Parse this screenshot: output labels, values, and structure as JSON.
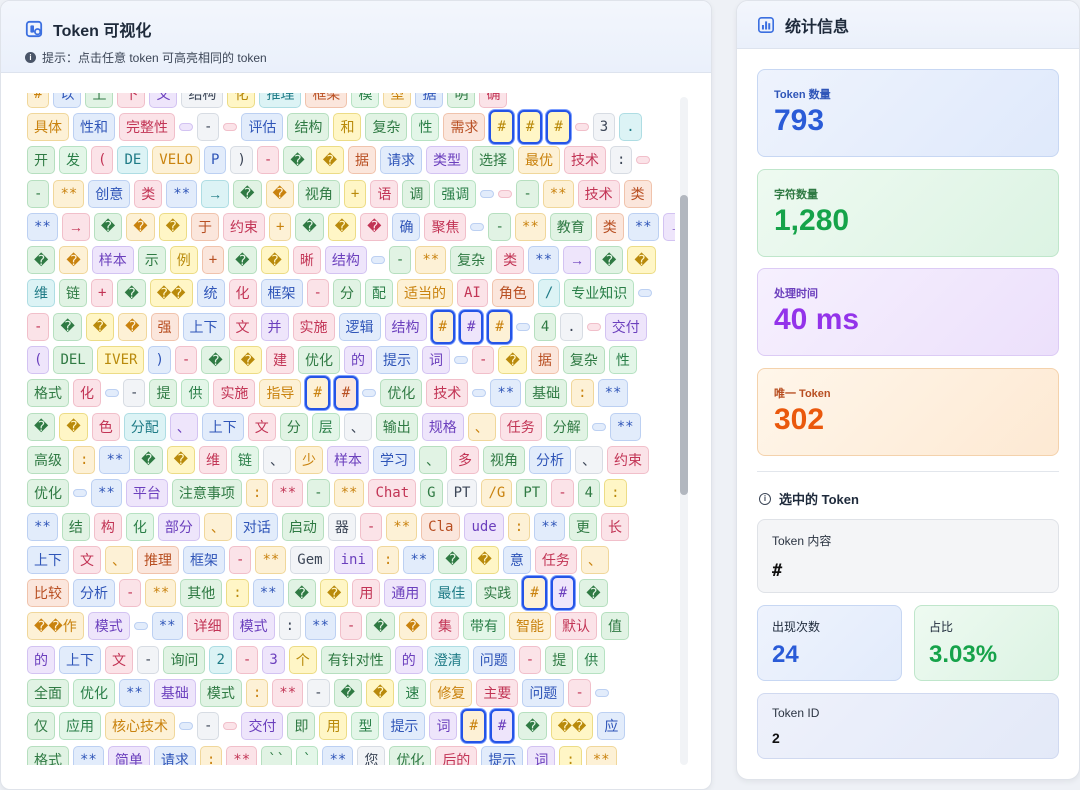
{
  "header": {
    "title": "Token 可视化",
    "hint": "提示：点击任意 token 可高亮相同的 token"
  },
  "token_rows": [
    [
      [
        "#",
        0
      ],
      [
        "以",
        1
      ],
      [
        "上",
        2
      ],
      [
        "下",
        3
      ],
      [
        "文",
        4
      ],
      [
        "结构",
        5
      ],
      [
        "化",
        6
      ],
      [
        "推理",
        7
      ],
      [
        "框架",
        8
      ],
      [
        "模",
        9
      ],
      [
        "型",
        0
      ],
      [
        "据",
        1
      ],
      [
        "明",
        2
      ],
      [
        "确",
        3
      ]
    ],
    [
      [
        "具体",
        0
      ],
      [
        "性和",
        1
      ],
      [
        "完整性",
        3
      ],
      [
        "",
        4
      ],
      [
        "-",
        5
      ],
      [
        "",
        3
      ],
      [
        "评估",
        1
      ],
      [
        "结构",
        2
      ],
      [
        "和",
        6
      ],
      [
        "复杂",
        2
      ],
      [
        "性",
        9
      ],
      [
        "需求",
        8
      ],
      [
        "#",
        6,
        1
      ],
      [
        "#",
        6,
        1
      ],
      [
        "#",
        6,
        1
      ],
      [
        "",
        3
      ],
      [
        "3",
        5
      ],
      [
        ".",
        7
      ]
    ],
    [
      [
        "开",
        2
      ],
      [
        "发",
        9
      ],
      [
        "(",
        3
      ],
      [
        "DE",
        7
      ],
      [
        "VELO",
        0
      ],
      [
        "P",
        1
      ],
      [
        ")",
        5
      ],
      [
        "-",
        3
      ],
      [
        "�",
        2
      ],
      [
        "�",
        6
      ],
      [
        "据",
        8
      ],
      [
        "请求",
        1
      ],
      [
        "类型",
        4
      ],
      [
        "选择",
        2
      ],
      [
        "最优",
        0
      ],
      [
        "技术",
        3
      ],
      [
        ":",
        5
      ],
      [
        "",
        3
      ]
    ],
    [
      [
        "-",
        2
      ],
      [
        "**",
        0
      ],
      [
        "创意",
        1
      ],
      [
        "类",
        3
      ],
      [
        "**",
        1
      ],
      [
        "→",
        7
      ],
      [
        "�",
        2
      ],
      [
        "�",
        0
      ],
      [
        "视角",
        2
      ],
      [
        "+",
        6
      ],
      [
        "语",
        3
      ],
      [
        "调",
        2
      ],
      [
        "强调",
        9
      ],
      [
        "",
        1
      ],
      [
        "",
        3
      ],
      [
        "-",
        2
      ],
      [
        "**",
        0
      ],
      [
        "技术",
        3
      ],
      [
        "类",
        8
      ]
    ],
    [
      [
        "**",
        1
      ],
      [
        "→",
        3
      ],
      [
        "�",
        2
      ],
      [
        "�",
        0
      ],
      [
        "�",
        6
      ],
      [
        "于",
        8
      ],
      [
        "约束",
        3
      ],
      [
        "+",
        0
      ],
      [
        "�",
        2
      ],
      [
        "�",
        6
      ],
      [
        "�",
        3
      ],
      [
        "确",
        1
      ],
      [
        "聚焦",
        3
      ],
      [
        "",
        1
      ],
      [
        "-",
        2
      ],
      [
        "**",
        0
      ],
      [
        "教育",
        2
      ],
      [
        "类",
        8
      ],
      [
        "**",
        1
      ],
      [
        "→",
        4
      ]
    ],
    [
      [
        "�",
        2
      ],
      [
        "�",
        0
      ],
      [
        "样本",
        4
      ],
      [
        "示",
        2
      ],
      [
        "例",
        6
      ],
      [
        "+",
        8
      ],
      [
        "�",
        2
      ],
      [
        "�",
        6
      ],
      [
        "晰",
        3
      ],
      [
        "结构",
        4
      ],
      [
        "",
        1
      ],
      [
        "-",
        2
      ],
      [
        "**",
        0
      ],
      [
        "复杂",
        2
      ],
      [
        "类",
        3
      ],
      [
        "**",
        1
      ],
      [
        "→",
        4
      ],
      [
        "�",
        2
      ],
      [
        "�",
        6
      ]
    ],
    [
      [
        "维",
        7
      ],
      [
        "链",
        2
      ],
      [
        "+",
        3
      ],
      [
        "�",
        2
      ],
      [
        "��",
        6
      ],
      [
        "统",
        1
      ],
      [
        "化",
        3
      ],
      [
        "框架",
        1
      ],
      [
        "-",
        3
      ],
      [
        "分",
        2
      ],
      [
        "配",
        9
      ],
      [
        "适当的",
        0
      ],
      [
        "AI",
        3
      ],
      [
        "角色",
        8
      ],
      [
        "/",
        7
      ],
      [
        "专业知识",
        9
      ],
      [
        "",
        1
      ]
    ],
    [
      [
        "-",
        3
      ],
      [
        "�",
        2
      ],
      [
        "�",
        6
      ],
      [
        "�",
        0
      ],
      [
        "强",
        8
      ],
      [
        "上下",
        1
      ],
      [
        "文",
        3
      ],
      [
        "并",
        4
      ],
      [
        "实施",
        3
      ],
      [
        "逻辑",
        1
      ],
      [
        "结构",
        4
      ],
      [
        "#",
        0,
        1
      ],
      [
        "#",
        4,
        1
      ],
      [
        "#",
        0,
        1
      ],
      [
        "",
        1
      ],
      [
        "4",
        2
      ],
      [
        ".",
        5
      ],
      [
        "",
        3
      ],
      [
        "交付",
        4
      ]
    ],
    [
      [
        "(",
        4
      ],
      [
        "DEL",
        2
      ],
      [
        "IVER",
        6
      ],
      [
        ")",
        1
      ],
      [
        "-",
        3
      ],
      [
        "�",
        2
      ],
      [
        "�",
        6
      ],
      [
        "建",
        3
      ],
      [
        "优化",
        2
      ],
      [
        "的",
        4
      ],
      [
        "提示",
        1
      ],
      [
        "词",
        4
      ],
      [
        "",
        1
      ],
      [
        "-",
        3
      ],
      [
        "�",
        6
      ],
      [
        "据",
        8
      ],
      [
        "复杂",
        2
      ],
      [
        "性",
        9
      ]
    ],
    [
      [
        "格式",
        2
      ],
      [
        "化",
        3
      ],
      [
        "",
        1
      ],
      [
        "-",
        5
      ],
      [
        "提",
        2
      ],
      [
        "供",
        9
      ],
      [
        "实施",
        3
      ],
      [
        "指导",
        0
      ],
      [
        "#",
        0,
        1
      ],
      [
        "#",
        8,
        1
      ],
      [
        "",
        1
      ],
      [
        "优化",
        2
      ],
      [
        "技术",
        3
      ],
      [
        "",
        1
      ],
      [
        "**",
        1
      ],
      [
        "基础",
        2
      ],
      [
        ":",
        0
      ],
      [
        "**",
        1
      ]
    ],
    [
      [
        "�",
        2
      ],
      [
        "�",
        6
      ],
      [
        "色",
        3
      ],
      [
        "分配",
        7
      ],
      [
        "、",
        4
      ],
      [
        "上下",
        1
      ],
      [
        "文",
        3
      ],
      [
        "分",
        2
      ],
      [
        "层",
        9
      ],
      [
        "、",
        5
      ],
      [
        "输出",
        2
      ],
      [
        "规格",
        4
      ],
      [
        "、",
        0
      ],
      [
        "任务",
        3
      ],
      [
        "分解",
        2
      ],
      [
        "",
        1
      ],
      [
        "**",
        1
      ]
    ],
    [
      [
        "高级",
        2
      ],
      [
        ":",
        0
      ],
      [
        "**",
        1
      ],
      [
        "�",
        2
      ],
      [
        "�",
        6
      ],
      [
        "维",
        3
      ],
      [
        "链",
        9
      ],
      [
        "、",
        5
      ],
      [
        "少",
        0
      ],
      [
        "样本",
        4
      ],
      [
        "学习",
        1
      ],
      [
        "、",
        2
      ],
      [
        "多",
        3
      ],
      [
        "视角",
        2
      ],
      [
        "分析",
        1
      ],
      [
        "、",
        5
      ],
      [
        "约束",
        3
      ]
    ],
    [
      [
        "优化",
        2
      ],
      [
        "",
        1
      ],
      [
        "**",
        1
      ],
      [
        "平台",
        4
      ],
      [
        "注意事项",
        2
      ],
      [
        ":",
        0
      ],
      [
        "**",
        3
      ],
      [
        "-",
        2
      ],
      [
        "**",
        0
      ],
      [
        "Chat",
        3
      ],
      [
        "G",
        2
      ],
      [
        "PT",
        5
      ],
      [
        "/G",
        0
      ],
      [
        "PT",
        2
      ],
      [
        "-",
        3
      ],
      [
        "4",
        2
      ],
      [
        ":",
        6
      ]
    ],
    [
      [
        "**",
        1
      ],
      [
        "结",
        2
      ],
      [
        "构",
        3
      ],
      [
        "化",
        9
      ],
      [
        "部分",
        4
      ],
      [
        "、",
        0
      ],
      [
        "对话",
        1
      ],
      [
        "启动",
        2
      ],
      [
        "器",
        5
      ],
      [
        "-",
        3
      ],
      [
        "**",
        0
      ],
      [
        "Cla",
        8
      ],
      [
        "ude",
        4
      ],
      [
        ":",
        0
      ],
      [
        "**",
        1
      ],
      [
        "更",
        2
      ],
      [
        "长",
        3
      ]
    ],
    [
      [
        "上下",
        1
      ],
      [
        "文",
        3
      ],
      [
        "、",
        0
      ],
      [
        "推理",
        8
      ],
      [
        "框架",
        1
      ],
      [
        "-",
        3
      ],
      [
        "**",
        0
      ],
      [
        "Gem",
        5
      ],
      [
        "ini",
        4
      ],
      [
        ":",
        0
      ],
      [
        "**",
        1
      ],
      [
        "�",
        2
      ],
      [
        "�",
        6
      ],
      [
        "意",
        1
      ],
      [
        "任务",
        3
      ],
      [
        "、",
        0
      ]
    ],
    [
      [
        "比较",
        8
      ],
      [
        "分析",
        1
      ],
      [
        "-",
        3
      ],
      [
        "**",
        0
      ],
      [
        "其他",
        2
      ],
      [
        ":",
        6
      ],
      [
        "**",
        1
      ],
      [
        "�",
        2
      ],
      [
        "�",
        6
      ],
      [
        "用",
        3
      ],
      [
        "通用",
        4
      ],
      [
        "最佳",
        7
      ],
      [
        "实践",
        2
      ],
      [
        "#",
        0,
        1
      ],
      [
        "#",
        4,
        1
      ],
      [
        "�",
        2
      ]
    ],
    [
      [
        "��作",
        0
      ],
      [
        "模式",
        4
      ],
      [
        "",
        1
      ],
      [
        "**",
        1
      ],
      [
        "详细",
        3
      ],
      [
        "模式",
        4
      ],
      [
        ":",
        5
      ],
      [
        "**",
        1
      ],
      [
        "-",
        3
      ],
      [
        "�",
        2
      ],
      [
        "�",
        0
      ],
      [
        "集",
        3
      ],
      [
        "带有",
        9
      ],
      [
        "智能",
        0
      ],
      [
        "默认",
        3
      ],
      [
        "值",
        2
      ]
    ],
    [
      [
        "的",
        4
      ],
      [
        "上下",
        1
      ],
      [
        "文",
        3
      ],
      [
        "-",
        5
      ],
      [
        "询问",
        2
      ],
      [
        "2",
        7
      ],
      [
        "-",
        3
      ],
      [
        "3",
        4
      ],
      [
        "个",
        6
      ],
      [
        "有针对性",
        2
      ],
      [
        "的",
        4
      ],
      [
        "澄清",
        7
      ],
      [
        "问题",
        1
      ],
      [
        "-",
        3
      ],
      [
        "提",
        2
      ],
      [
        "供",
        9
      ]
    ],
    [
      [
        "全面",
        2
      ],
      [
        "优化",
        9
      ],
      [
        "**",
        1
      ],
      [
        "基础",
        4
      ],
      [
        "模式",
        2
      ],
      [
        ":",
        0
      ],
      [
        "**",
        3
      ],
      [
        "-",
        5
      ],
      [
        "�",
        2
      ],
      [
        "�",
        6
      ],
      [
        "速",
        9
      ],
      [
        "修复",
        0
      ],
      [
        "主要",
        3
      ],
      [
        "问题",
        1
      ],
      [
        "-",
        3
      ],
      [
        "",
        1
      ]
    ],
    [
      [
        "仅",
        2
      ],
      [
        "应用",
        9
      ],
      [
        "核心技术",
        0
      ],
      [
        "",
        1
      ],
      [
        "-",
        5
      ],
      [
        "",
        3
      ],
      [
        "交付",
        4
      ],
      [
        "即",
        2
      ],
      [
        "用",
        6
      ],
      [
        "型",
        9
      ],
      [
        "提示",
        1
      ],
      [
        "词",
        4
      ],
      [
        "#",
        0,
        1
      ],
      [
        "#",
        4,
        1
      ],
      [
        "�",
        2
      ],
      [
        "��",
        6
      ],
      [
        "应",
        1
      ]
    ],
    [
      [
        "格式",
        2
      ],
      [
        "**",
        1
      ],
      [
        "简单",
        4
      ],
      [
        "请求",
        1
      ],
      [
        ":",
        0
      ],
      [
        "**",
        3
      ],
      [
        "``",
        2
      ],
      [
        "`",
        9
      ],
      [
        "**",
        1
      ],
      [
        "您",
        5
      ],
      [
        "优化",
        2
      ],
      [
        "后的",
        3
      ],
      [
        "提示",
        1
      ],
      [
        "词",
        4
      ],
      [
        ":",
        6
      ],
      [
        "**",
        0
      ]
    ]
  ],
  "scrollbar": {},
  "stats": {
    "title": "统计信息",
    "token_count_label": "Token 数量",
    "token_count_value": "793",
    "char_count_label": "字符数量",
    "char_count_value": "1,280",
    "time_label": "处理时间",
    "time_value": "40 ms",
    "unique_label": "唯一 Token",
    "unique_value": "302"
  },
  "selected": {
    "title": "选中的 Token",
    "content_label": "Token 内容",
    "content_value": "#",
    "count_label": "出现次数",
    "count_value": "24",
    "ratio_label": "占比",
    "ratio_value": "3.03%",
    "id_label": "Token ID",
    "id_value": "2"
  }
}
